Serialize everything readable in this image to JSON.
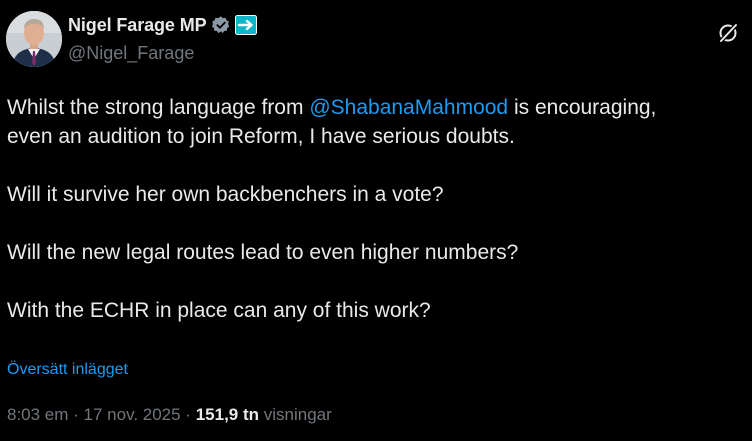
{
  "author": {
    "display_name": "Nigel Farage MP",
    "handle": "@Nigel_Farage",
    "avatar_icon": "profile-photo",
    "verified_icon": "verified-badge-icon",
    "affiliate_icon": "affiliation-flag-icon"
  },
  "tweet": {
    "line1_before": "Whilst the strong language from ",
    "mention": "@ShabanaMahmood",
    "line1_after": " is encouraging,",
    "line2": "even an audition to join Reform, I have serious doubts.",
    "line3": "Will it survive her own backbenchers in a vote?",
    "line4": "Will the new legal routes lead to even higher numbers?",
    "line5": "With the ECHR in place can any of this work?"
  },
  "translate_label": "Översätt inlägget",
  "meta": {
    "time": "8:03 em",
    "separator1": " · ",
    "date": "17 nov. 2025",
    "separator2": " · ",
    "views_count": "151,9 tn",
    "views_label": " visningar"
  },
  "colors": {
    "background": "#000000",
    "text": "#e7e9ea",
    "secondary": "#71767b",
    "link": "#1d9bf0"
  }
}
